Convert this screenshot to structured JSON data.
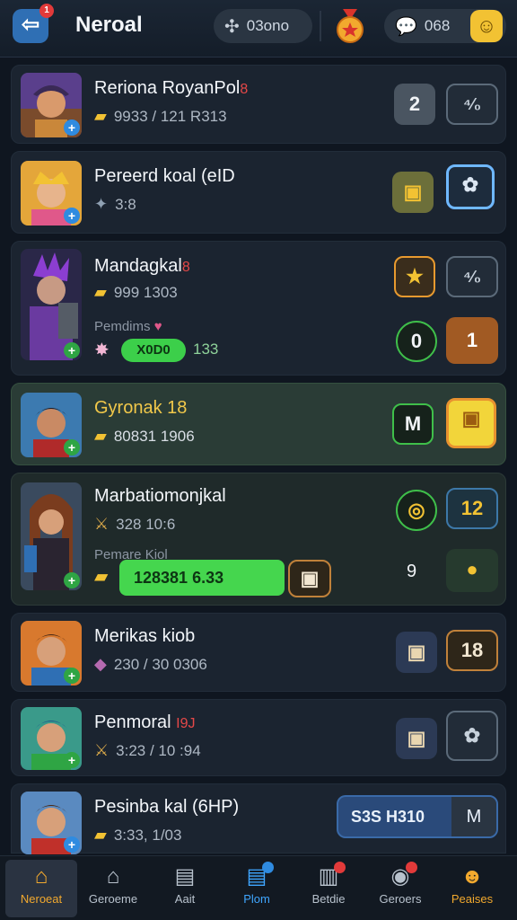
{
  "header": {
    "title": "Neroal",
    "back_badge": "1",
    "currency_a": "03ono",
    "currency_b": "068"
  },
  "rows": [
    {
      "name": "Reriona RoyanPol",
      "name_mark": "8",
      "stat": "9933 / 121 R313",
      "btn1": "2",
      "btn2": "⁴⁄₀"
    },
    {
      "name": "Pereerd koal (eID",
      "stat": "3:8"
    },
    {
      "name": "Mandagkal",
      "name_mark": "8",
      "stat": "999 1303",
      "sub": "Pemdims",
      "pill": "X0D0",
      "pill_value": "133",
      "btn3": "0",
      "btn4": "1"
    },
    {
      "name": "Gyronak 18",
      "stat": "80831 1906",
      "btn1": "M"
    },
    {
      "name": "Marbatiomonjkal",
      "stat": "328 10:6",
      "sub": "Pemare Kiol",
      "bar": "128381 6.33",
      "btn1": "12",
      "side_num": "9"
    },
    {
      "name": "Merikas kiob",
      "stat": "230 / 30 0306",
      "btn2": "18"
    },
    {
      "name": "Penmoral",
      "name_mark": "I9J",
      "stat": "3:23 / 10 :94"
    },
    {
      "name": "Pesinba kal (6HP)",
      "stat": "3:33, 1/03",
      "pill_label": "S3S H310",
      "pill_btn": "M"
    }
  ],
  "nav": [
    {
      "label": "Neroeat"
    },
    {
      "label": "Geroeme"
    },
    {
      "label": "Aait"
    },
    {
      "label": "Plom"
    },
    {
      "label": "Betdie"
    },
    {
      "label": "Geroers"
    },
    {
      "label": "Peaises"
    }
  ]
}
